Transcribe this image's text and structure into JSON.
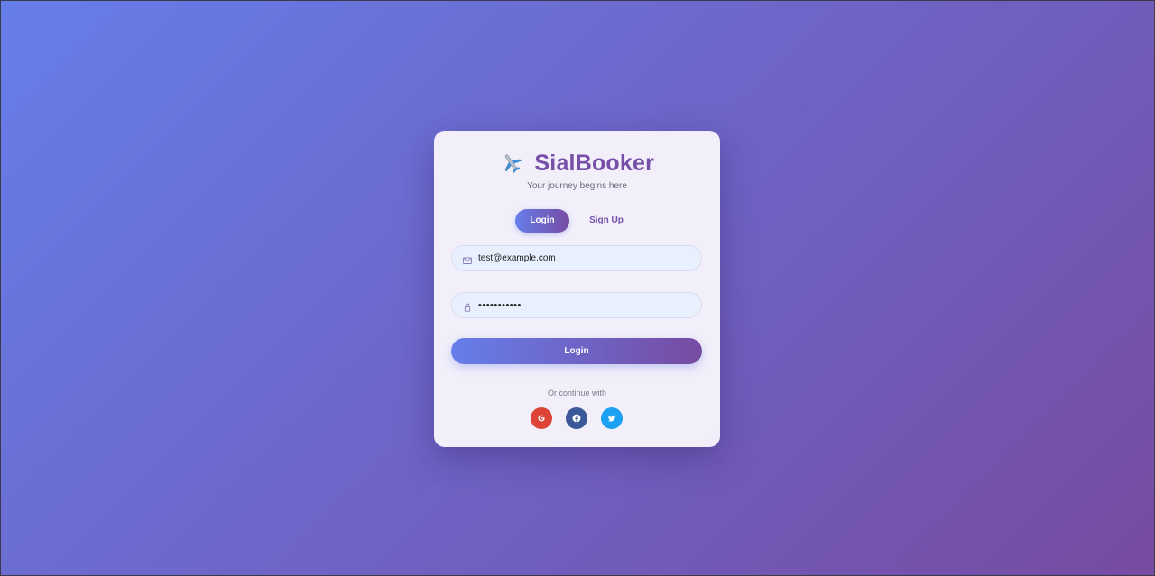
{
  "brand": {
    "icon": "airplane-icon",
    "title": "SialBooker",
    "tagline": "Your journey begins here"
  },
  "tabs": [
    {
      "label": "Login",
      "active": true
    },
    {
      "label": "Sign Up",
      "active": false
    }
  ],
  "form": {
    "email": {
      "icon": "envelope-icon",
      "value": "test@example.com"
    },
    "password": {
      "icon": "lock-icon",
      "value": "password123"
    },
    "submit_label": "Login"
  },
  "social": {
    "label": "Or continue with",
    "providers": [
      {
        "name": "google",
        "icon": "google-icon",
        "color": "#db4437"
      },
      {
        "name": "facebook",
        "icon": "facebook-icon",
        "color": "#3b5998"
      },
      {
        "name": "twitter",
        "icon": "twitter-icon",
        "color": "#1da1f2"
      }
    ]
  },
  "colors": {
    "background_start": "#667eea",
    "background_end": "#764ba2",
    "brand_text": "#7650a8",
    "input_bg": "#e9f0fd"
  }
}
